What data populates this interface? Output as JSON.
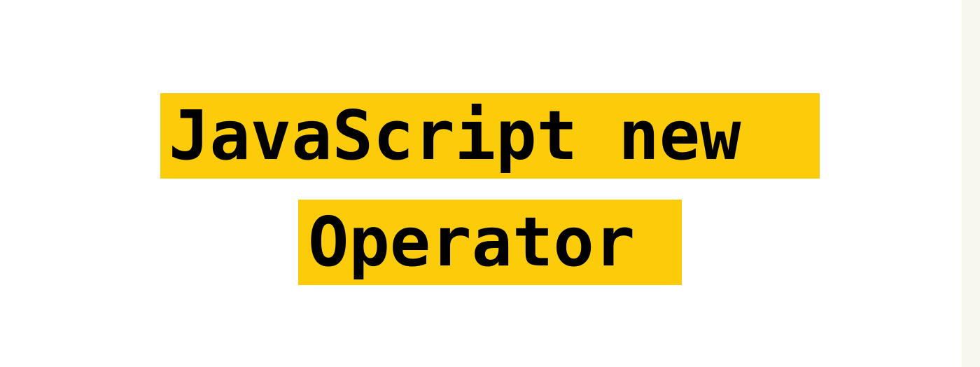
{
  "title": {
    "line1": "JavaScript new",
    "line2": "Operator"
  },
  "colors": {
    "background": "#ffffff",
    "highlight": "#fccc0a",
    "text": "#000000",
    "edge": "#f7f7ee"
  }
}
